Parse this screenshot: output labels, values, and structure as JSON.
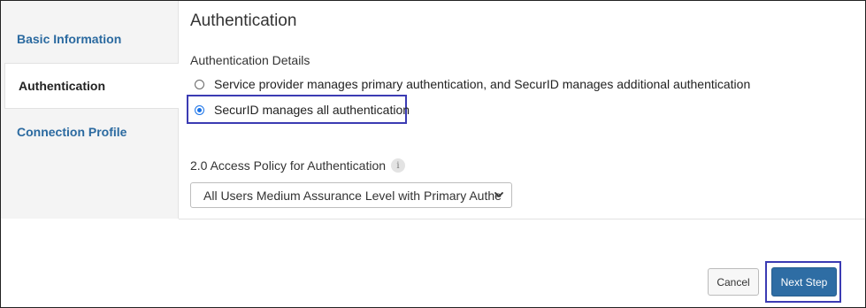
{
  "sidebar": {
    "items": [
      {
        "label": "Basic Information"
      },
      {
        "label": "Authentication"
      },
      {
        "label": "Connection Profile"
      }
    ]
  },
  "main": {
    "title": "Authentication",
    "details_label": "Authentication Details",
    "options": [
      {
        "label": "Service provider manages primary authentication, and SecurID manages additional authentication",
        "selected": false
      },
      {
        "label": "SecurID manages all authentication",
        "selected": true
      }
    ],
    "policy_label": "2.0 Access Policy for Authentication",
    "policy_info_icon": "i",
    "policy_value": "All Users Medium Assurance Level with Primary Authe"
  },
  "footer": {
    "cancel_label": "Cancel",
    "next_label": "Next Step"
  },
  "colors": {
    "link": "#2b6aa0",
    "primary_button": "#2e6da4",
    "highlight": "#3b3bb3",
    "radio_selected": "#1a73e8"
  }
}
